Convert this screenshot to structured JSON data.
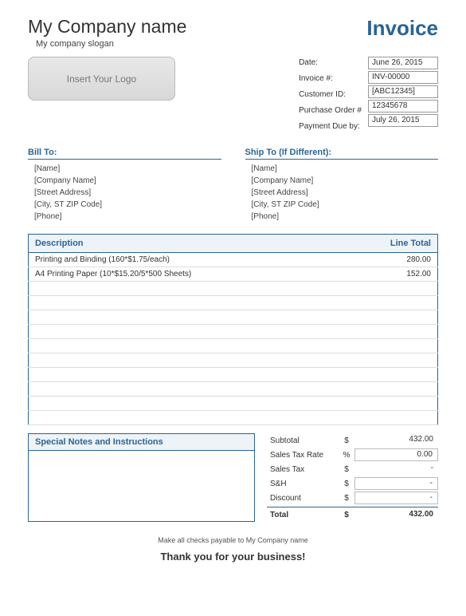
{
  "header": {
    "company_name": "My Company name",
    "company_slogan": "My company slogan",
    "invoice_title": "Invoice",
    "logo_placeholder": "Insert Your Logo"
  },
  "meta": {
    "labels": {
      "date": "Date:",
      "invoice_no": "Invoice #:",
      "customer_id": "Customer ID:",
      "po": "Purchase Order #",
      "due": "Payment Due by:"
    },
    "values": {
      "date": "June 26, 2015",
      "invoice_no": "INV-00000",
      "customer_id": "[ABC12345]",
      "po": "12345678",
      "due": "July 26, 2015"
    }
  },
  "bill_to": {
    "title": "Bill To:",
    "name": "[Name]",
    "company": "[Company Name]",
    "street": "[Street Address]",
    "city": "[City, ST ZIP Code]",
    "phone": "[Phone]"
  },
  "ship_to": {
    "title": "Ship To (If Different):",
    "name": "[Name]",
    "company": "[Company Name]",
    "street": "[Street Address]",
    "city": "[City, ST ZIP Code]",
    "phone": "[Phone]"
  },
  "items": {
    "columns": {
      "description": "Description",
      "line_total": "Line Total"
    },
    "rows": [
      {
        "description": "Printing and Binding (160*$1.75/each)",
        "line_total": "280.00"
      },
      {
        "description": "A4 Printing Paper (10*$15.20/5*500 Sheets)",
        "line_total": "152.00"
      }
    ]
  },
  "notes": {
    "title": "Special Notes and Instructions"
  },
  "totals": {
    "subtotal_label": "Subtotal",
    "subtotal_sym": "$",
    "subtotal_val": "432.00",
    "taxrate_label": "Sales Tax Rate",
    "taxrate_sym": "%",
    "taxrate_val": "0.00",
    "tax_label": "Sales Tax",
    "tax_sym": "$",
    "tax_val": "-",
    "sh_label": "S&H",
    "sh_sym": "$",
    "sh_val": "-",
    "discount_label": "Discount",
    "discount_sym": "$",
    "discount_val": "-",
    "total_label": "Total",
    "total_sym": "$",
    "total_val": "432.00"
  },
  "footer": {
    "payable": "Make all checks payable to My Company name",
    "thanks": "Thank you for your business!"
  }
}
